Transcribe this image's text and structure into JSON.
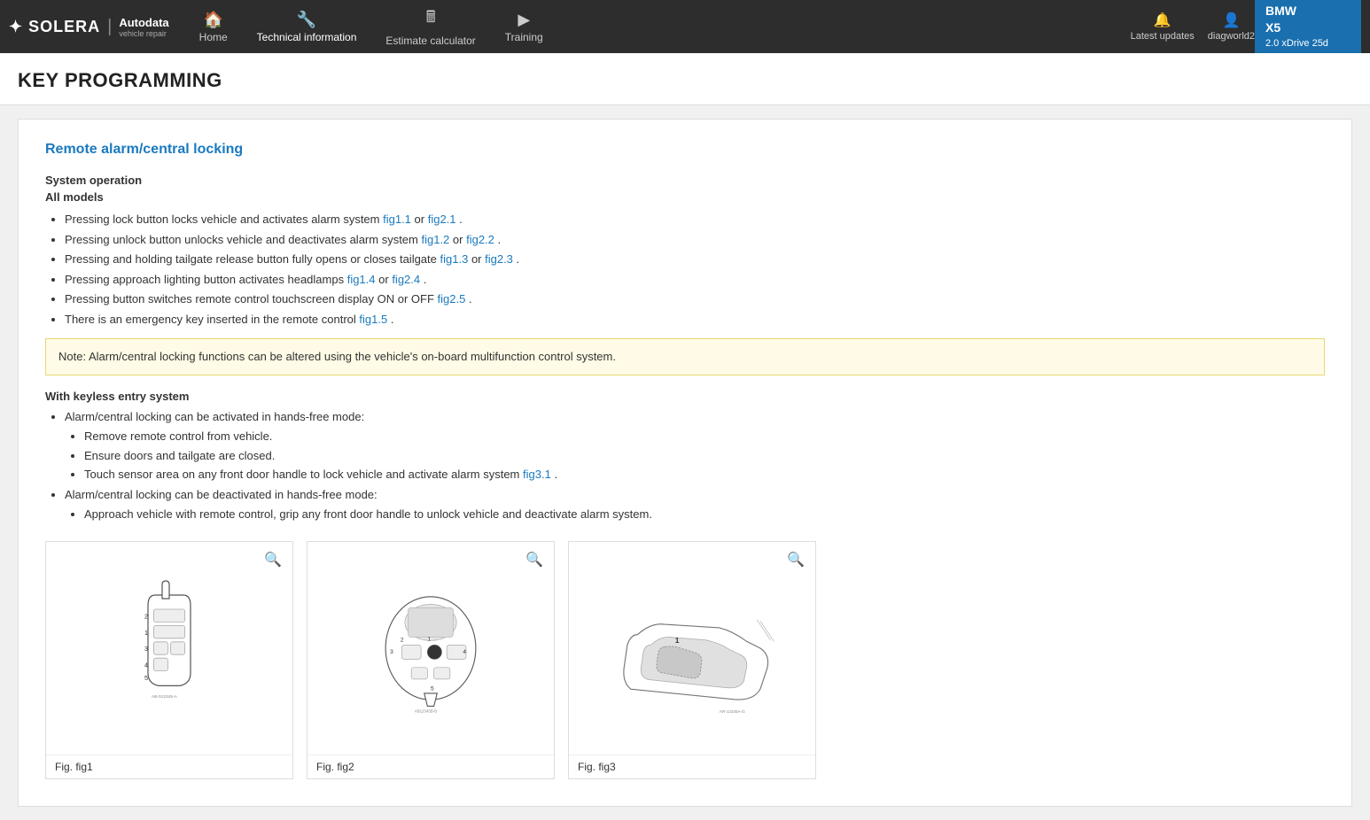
{
  "logo": {
    "brand": "SOLERA",
    "separator": "|",
    "product": "Autodata",
    "tagline": "vehicle repair"
  },
  "nav": {
    "items": [
      {
        "id": "home",
        "label": "Home",
        "icon": "🏠",
        "active": false
      },
      {
        "id": "technical",
        "label": "Technical information",
        "icon": "🔧",
        "active": true
      },
      {
        "id": "estimate",
        "label": "Estimate calculator",
        "icon": "🖩",
        "active": false
      },
      {
        "id": "training",
        "label": "Training",
        "icon": "▶",
        "active": false
      }
    ],
    "right": [
      {
        "id": "updates",
        "label": "Latest updates",
        "icon": "🔔"
      },
      {
        "id": "account",
        "label": "diagworld2",
        "icon": "👤"
      }
    ]
  },
  "vehicle": {
    "make": "BMW",
    "model": "X5",
    "engine": "2.0 xDrive 25d"
  },
  "page": {
    "title": "KEY PROGRAMMING"
  },
  "content": {
    "section_title": "Remote alarm/central locking",
    "system_operation_title": "System operation",
    "all_models_title": "All models",
    "bullets": [
      {
        "text": "Pressing lock button locks vehicle and activates alarm system ",
        "links": [
          {
            "label": "fig1.1",
            "href": "#"
          },
          {
            "sep": " or "
          },
          {
            "label": "fig2.1",
            "href": "#"
          }
        ],
        "suffix": "."
      },
      {
        "text": "Pressing unlock button unlocks vehicle and deactivates alarm system ",
        "links": [
          {
            "label": "fig1.2",
            "href": "#"
          },
          {
            "sep": " or "
          },
          {
            "label": "fig2.2",
            "href": "#"
          }
        ],
        "suffix": "."
      },
      {
        "text": "Pressing and holding tailgate release button fully opens or closes tailgate ",
        "links": [
          {
            "label": "fig1.3",
            "href": "#"
          },
          {
            "sep": " or "
          },
          {
            "label": "fig2.3",
            "href": "#"
          }
        ],
        "suffix": "."
      },
      {
        "text": "Pressing approach lighting button activates headlamps ",
        "links": [
          {
            "label": "fig1.4",
            "href": "#"
          },
          {
            "sep": " or "
          },
          {
            "label": "fig2.4",
            "href": "#"
          }
        ],
        "suffix": "."
      },
      {
        "text": "Pressing button switches remote control touchscreen display ON or OFF ",
        "links": [
          {
            "label": "fig2.5",
            "href": "#"
          }
        ],
        "suffix": "."
      },
      {
        "text": "There is an emergency key inserted in the remote control ",
        "links": [
          {
            "label": "fig1.5",
            "href": "#"
          }
        ],
        "suffix": "."
      }
    ],
    "note": "Note: Alarm/central locking functions can be altered using the vehicle's on-board multifunction control system.",
    "keyless_title": "With keyless entry system",
    "keyless_bullets": [
      {
        "text": "Alarm/central locking can be activated in hands-free mode:",
        "sub": [
          "Remove remote control from vehicle.",
          "Ensure doors and tailgate are closed.",
          {
            "text": "Touch sensor area on any front door handle to lock vehicle and activate alarm system ",
            "link": "fig3.1",
            "suffix": "."
          }
        ]
      },
      {
        "text": "Alarm/central locking can be deactivated in hands-free mode:",
        "sub": [
          "Approach vehicle with remote control, grip any front door handle to unlock vehicle and deactivate alarm system."
        ]
      }
    ],
    "figures": [
      {
        "id": "fig1",
        "caption": "Fig. fig1"
      },
      {
        "id": "fig2",
        "caption": "Fig. fig2"
      },
      {
        "id": "fig3",
        "caption": "Fig. fig3"
      }
    ]
  }
}
